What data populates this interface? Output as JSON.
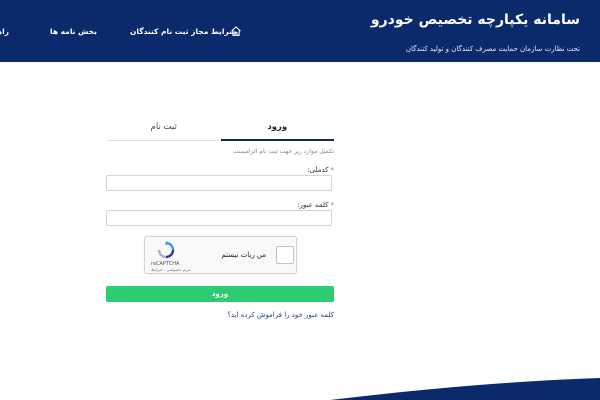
{
  "header": {
    "title": "سامانه یکپارچه تخصیص خودرو",
    "subtitle": "تحت نظارت سازمان حمایت مصرف کنندگان و تولید کنندگان",
    "nav": [
      {
        "label": "راهنما"
      },
      {
        "label": "بخش نامه ها"
      },
      {
        "label": "شرایط مجاز ثبت نام کنندگان"
      }
    ],
    "home_icon": "home-icon"
  },
  "form": {
    "tabs": [
      {
        "label": "ثبت نام",
        "active": false
      },
      {
        "label": "ورود",
        "active": true
      }
    ],
    "hint": "تکمیل موارد زیر جهت ثبت نام الزامیست",
    "national_code": {
      "label": "کدملی:",
      "required_mark": "*",
      "value": "",
      "placeholder": ""
    },
    "password": {
      "label": "کلمه عبور:",
      "required_mark": "*",
      "value": "",
      "placeholder": ""
    },
    "captcha": {
      "label": "من ربات نیستم",
      "brand": "reCAPTCHA",
      "links": "حریم خصوصی - شرایط"
    },
    "login_label": "ورود",
    "forgot_link": "کلمه عبور خود را فراموش کرده اید؟"
  },
  "colors": {
    "header_bg": "#0a2a6b",
    "button_bg": "#2ecc71",
    "link": "#2a3f8f"
  }
}
